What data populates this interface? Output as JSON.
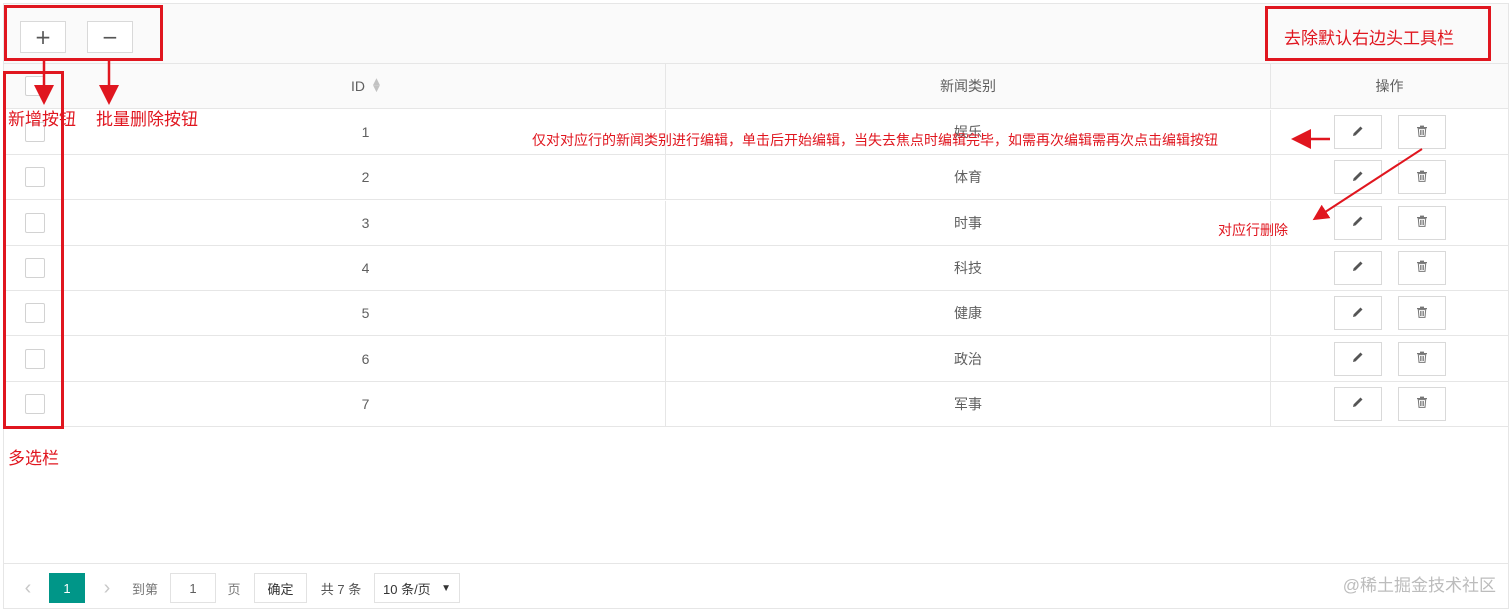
{
  "toolbar": {
    "add_icon": "+",
    "remove_icon": "−"
  },
  "table": {
    "headers": {
      "id": "ID",
      "type": "新闻类别",
      "ops": "操作"
    },
    "rows": [
      {
        "id": "1",
        "type": "娱乐"
      },
      {
        "id": "2",
        "type": "体育"
      },
      {
        "id": "3",
        "type": "时事"
      },
      {
        "id": "4",
        "type": "科技"
      },
      {
        "id": "5",
        "type": "健康"
      },
      {
        "id": "6",
        "type": "政治"
      },
      {
        "id": "7",
        "type": "军事"
      }
    ]
  },
  "pager": {
    "current_page": "1",
    "goto_label": "到第",
    "goto_value": "1",
    "page_unit": "页",
    "confirm": "确定",
    "total": "共 7 条",
    "page_size": "10 条/页"
  },
  "annotations": {
    "add_button": "新增按钮",
    "batch_delete": "批量删除按钮",
    "remove_toolbar": "去除默认右边头工具栏",
    "edit_note": "仅对对应行的新闻类别进行编辑，单击后开始编辑，当失去焦点时编辑完毕，如需再次编辑需再次点击编辑按钮",
    "row_delete": "对应行删除",
    "multi_select": "多选栏"
  },
  "watermark": "@稀土掘金技术社区",
  "colors": {
    "accent": "#009688",
    "annotation": "#e0161f",
    "border": "#e6e6e6"
  }
}
